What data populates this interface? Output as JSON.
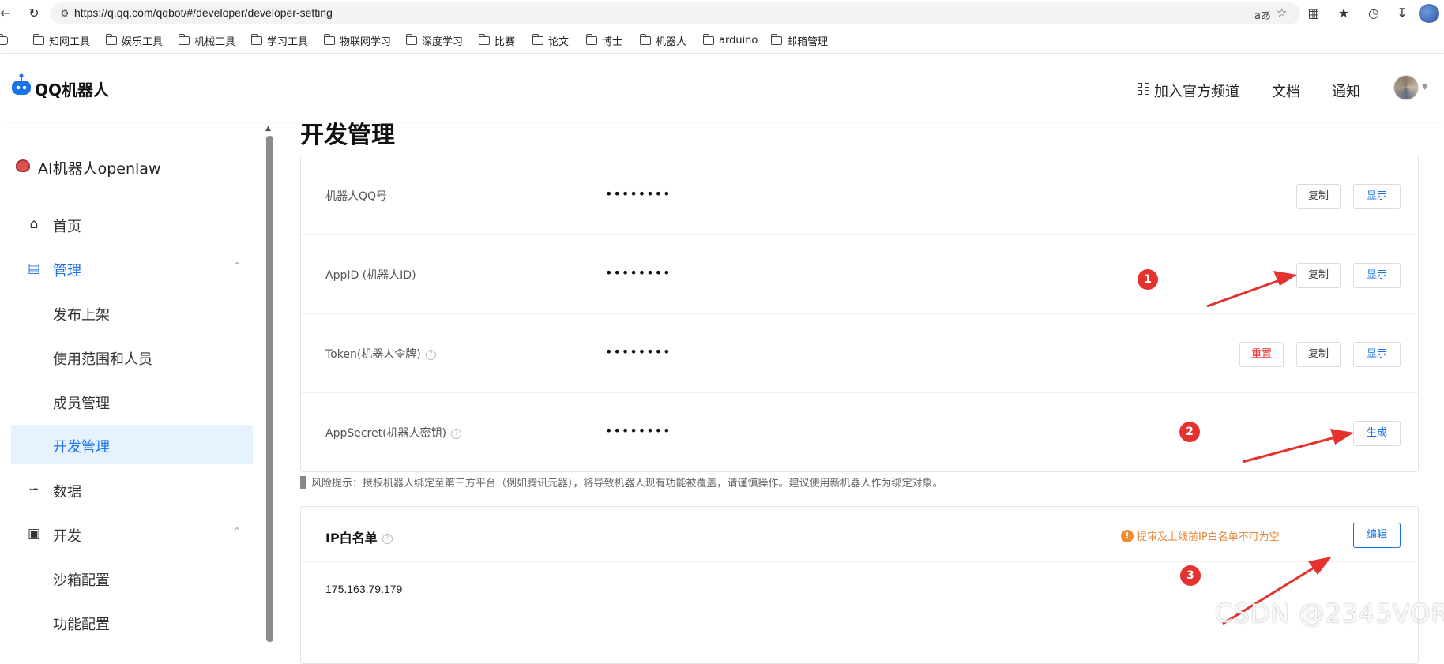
{
  "browser": {
    "url": "https://q.qq.com/qqbot/#/developer/developer-setting",
    "translate_label": "aあ",
    "bookmarks": [
      "知网工具",
      "娱乐工具",
      "机械工具",
      "学习工具",
      "物联网学习",
      "深度学习",
      "比赛",
      "论文",
      "博士",
      "机器人",
      "arduino",
      "邮箱管理"
    ]
  },
  "header": {
    "logo": "QQ机器人",
    "links": {
      "channel": "加入官方频道",
      "docs": "文档",
      "notice": "通知"
    }
  },
  "sidebar": {
    "bot_name": "AI机器人openlaw",
    "items": [
      {
        "label": "首页",
        "icon": "home-icon"
      },
      {
        "label": "管理",
        "icon": "manage-icon"
      },
      {
        "label": "发布上架"
      },
      {
        "label": "使用范围和人员"
      },
      {
        "label": "成员管理"
      },
      {
        "label": "开发管理"
      },
      {
        "label": "数据",
        "icon": "chart-icon"
      },
      {
        "label": "开发",
        "icon": "monitor-icon"
      },
      {
        "label": "沙箱配置"
      },
      {
        "label": "功能配置"
      }
    ]
  },
  "main": {
    "title": "开发管理",
    "credentials": [
      {
        "label": "机器人QQ号",
        "value": "••••••••",
        "buttons": {
          "copy": "复制",
          "show": "显示"
        }
      },
      {
        "label": "AppID (机器人ID)",
        "value": "••••••••",
        "buttons": {
          "copy": "复制",
          "show": "显示"
        }
      },
      {
        "label": "Token(机器人令牌)",
        "value": "••••••••",
        "buttons": {
          "reset": "重置",
          "copy": "复制",
          "show": "显示"
        }
      },
      {
        "label": "AppSecret(机器人密钥)",
        "value": "••••••••",
        "buttons": {
          "generate": "生成"
        }
      }
    ],
    "risk_tip": "风险提示：授权机器人绑定至第三方平台（例如腾讯元器），将导致机器人现有功能被覆盖，请谨慎操作。建议使用新机器人作为绑定对象。",
    "ip_whitelist": {
      "title": "IP白名单",
      "warning": "提审及上线前IP白名单不可为空",
      "edit": "编辑",
      "ip": "175.163.79.179"
    }
  },
  "annotations": [
    "1",
    "2",
    "3"
  ],
  "watermark": "CSDN @2345VOR",
  "colors": {
    "accent": "#1a73e8",
    "danger": "#e5322e",
    "warning": "#f08c2e",
    "selected_bg": "#e6f2fd"
  }
}
